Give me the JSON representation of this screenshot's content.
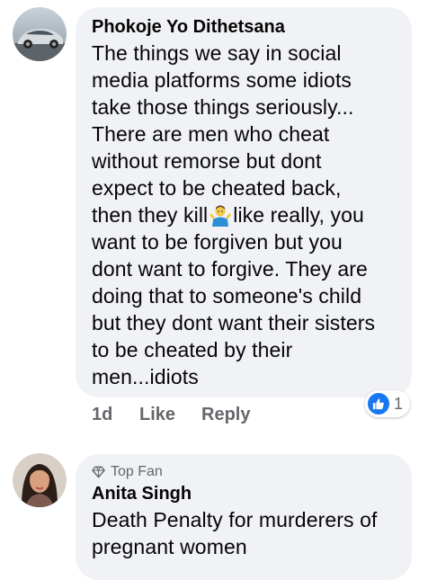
{
  "comments": [
    {
      "author": "Phokoje Yo Dithetsana",
      "lines": [
        "The things we say in social",
        "media platforms some idiots",
        "take those things seriously...",
        "There are men who cheat",
        "without remorse but dont",
        "expect to be cheated back,"
      ],
      "line_emoji_before": "then they kill",
      "emoji_icon": "person-shrugging-emoji",
      "line_emoji_after": "like really, you",
      "lines_after": [
        "want to be forgiven but you",
        "dont want to forgive. They are",
        "doing that to someone's child",
        "but they dont want their sisters",
        "to be cheated by their",
        "men...idiots"
      ],
      "time": "1d",
      "like_label": "Like",
      "reply_label": "Reply",
      "reaction_icon": "like-icon",
      "reaction_count": "1"
    },
    {
      "badge_icon": "diamond-icon",
      "badge": "Top Fan",
      "author": "Anita Singh",
      "lines": [
        "Death Penalty for murderers of",
        "pregnant women"
      ]
    }
  ],
  "colors": {
    "bubble": "#f0f2f5",
    "meta_text": "#65676b",
    "like_blue": "#1877f2"
  }
}
